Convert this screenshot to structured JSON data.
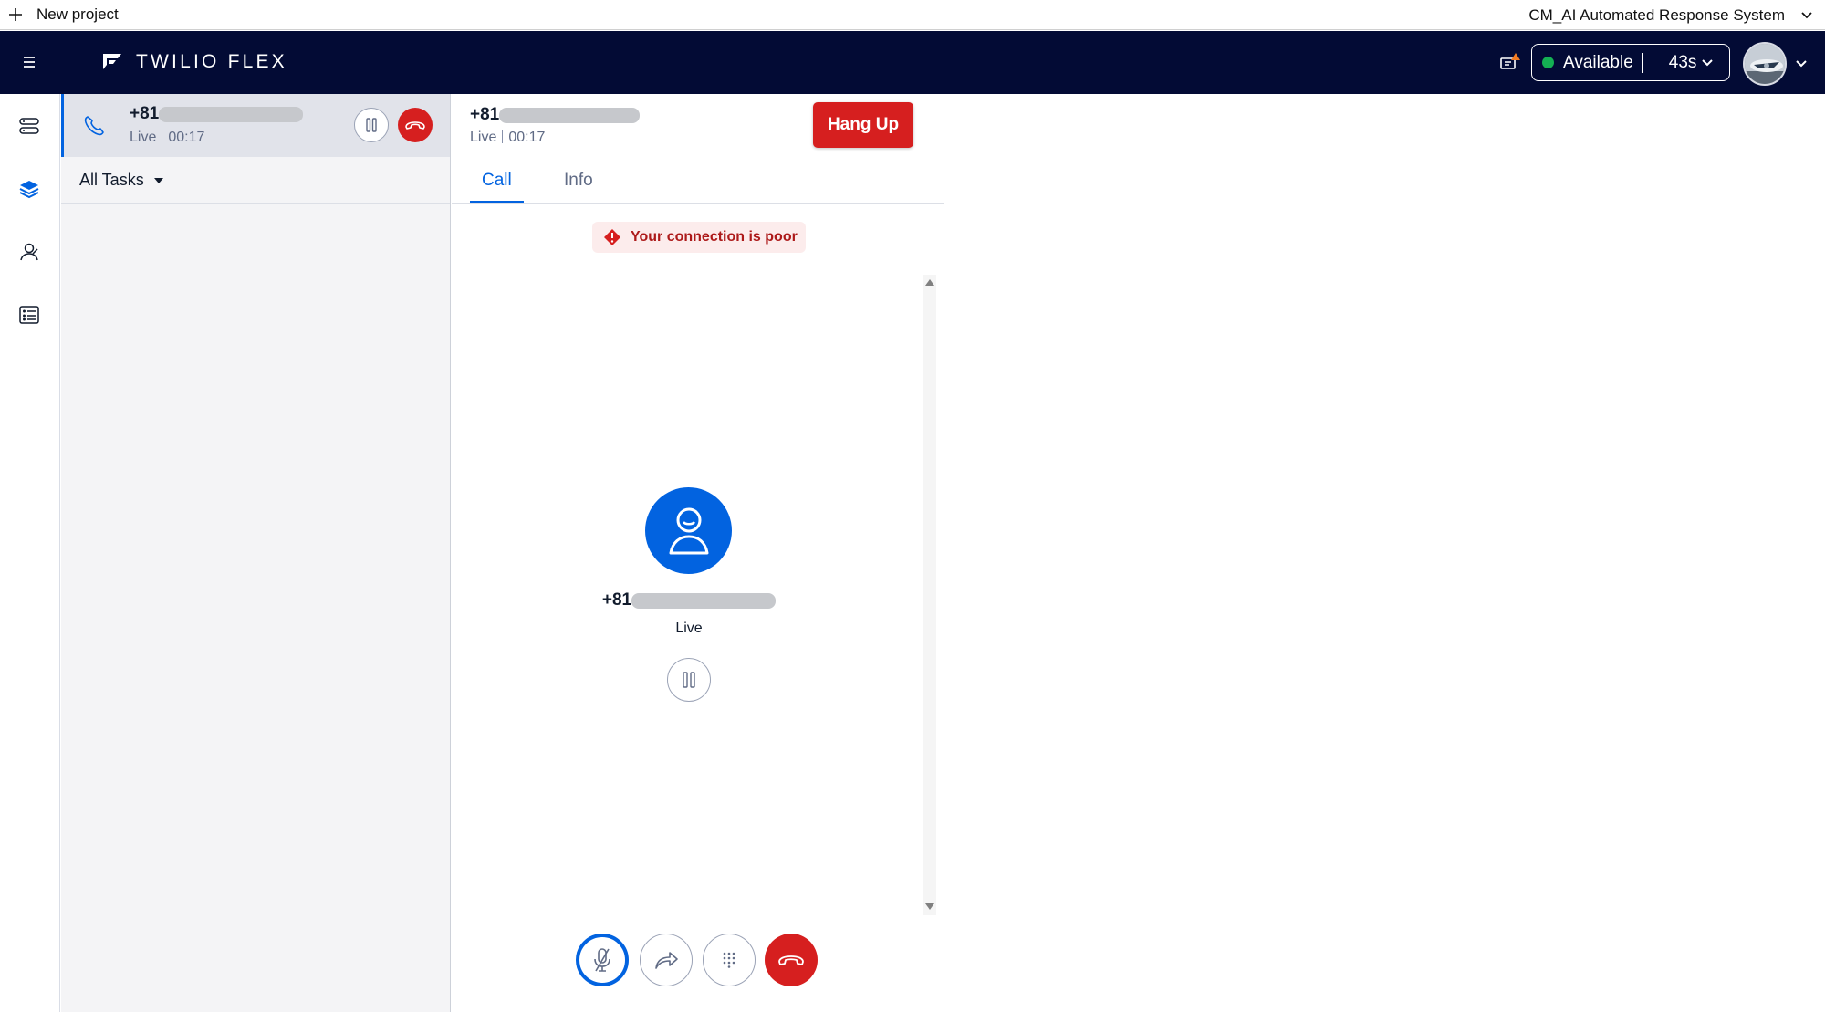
{
  "project_bar": {
    "new_project_label": "New project",
    "project_name": "CM_AI Automated Response System"
  },
  "header": {
    "brand": "TWILIO FLEX",
    "status": "Available",
    "status_timer": "43s",
    "status_color": "#14b053",
    "background": "#030b35"
  },
  "nav": {
    "items": [
      {
        "icon": "server-list-icon"
      },
      {
        "icon": "layers-icon",
        "active": true
      },
      {
        "icon": "contacts-icon"
      },
      {
        "icon": "form-list-icon"
      }
    ]
  },
  "task": {
    "number": "+81",
    "status": "Live",
    "timer": "00:17",
    "filter_label": "All Tasks"
  },
  "call": {
    "number": "+81",
    "status": "Live",
    "timer": "00:17",
    "hangup_label": "Hang Up",
    "tabs": [
      "Call",
      "Info"
    ],
    "active_tab": "Call",
    "warning": "Your connection is poor",
    "contact_status": "Live",
    "controls": [
      "mute-icon",
      "transfer-icon",
      "dialpad-icon",
      "hang-up-icon"
    ]
  },
  "colors": {
    "accent": "#0263e0",
    "danger": "#d61f1f"
  }
}
